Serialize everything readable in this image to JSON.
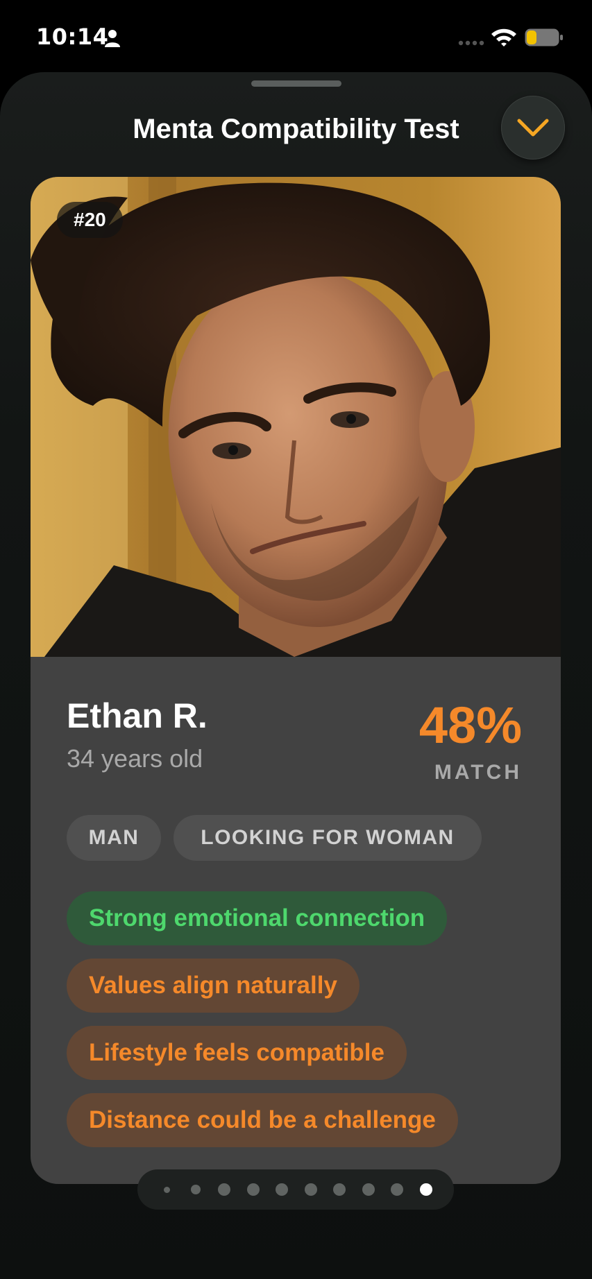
{
  "status_bar": {
    "time": "10:14"
  },
  "sheet": {
    "title": "Menta Compatibility Test"
  },
  "profile": {
    "rank": "#20",
    "name": "Ethan R.",
    "age": "34 years old",
    "match_value": "48%",
    "match_label": "MATCH",
    "tags": [
      "MAN",
      "LOOKING FOR WOMAN"
    ],
    "traits": [
      {
        "label": "Strong emotional connection",
        "tone": "positive"
      },
      {
        "label": "Values align naturally",
        "tone": "neutral"
      },
      {
        "label": "Lifestyle feels compatible",
        "tone": "neutral"
      },
      {
        "label": "Distance could be a challenge",
        "tone": "neutral"
      }
    ]
  },
  "pagination": {
    "total": 10,
    "current": 10
  },
  "colors": {
    "accent_orange": "#f5892a",
    "positive_green": "#4ed86d",
    "card_background": "#424242"
  }
}
